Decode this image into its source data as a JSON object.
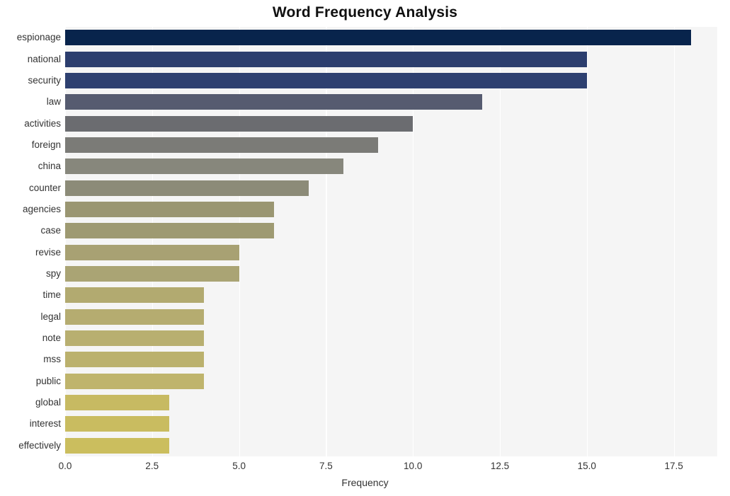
{
  "chart_data": {
    "type": "bar",
    "orientation": "horizontal",
    "title": "Word Frequency Analysis",
    "xlabel": "Frequency",
    "ylabel": "",
    "categories": [
      "espionage",
      "national",
      "security",
      "law",
      "activities",
      "foreign",
      "china",
      "counter",
      "agencies",
      "case",
      "revise",
      "spy",
      "time",
      "legal",
      "note",
      "mss",
      "public",
      "global",
      "interest",
      "effectively"
    ],
    "values": [
      18,
      15,
      15,
      12,
      10,
      9,
      8,
      7,
      6,
      6,
      5,
      5,
      4,
      4,
      4,
      4,
      4,
      3,
      3,
      3
    ],
    "bar_colors": [
      "#08244c",
      "#2c3e6e",
      "#2e4070",
      "#565b70",
      "#6b6c70",
      "#7b7b77",
      "#87877c",
      "#8c8b78",
      "#9a9672",
      "#9e9a72",
      "#a8a173",
      "#aaa474",
      "#b2aa70",
      "#b5ac70",
      "#b8af70",
      "#bbb16d",
      "#bfb46c",
      "#c7ba62",
      "#c9bc60",
      "#cbbe5e"
    ],
    "xticks": [
      "0.0",
      "2.5",
      "5.0",
      "7.5",
      "10.0",
      "12.5",
      "15.0",
      "17.5"
    ],
    "xtick_values": [
      0,
      2.5,
      5,
      7.5,
      10,
      12.5,
      15,
      17.5
    ],
    "xlim": [
      0,
      18.75
    ],
    "grid": true,
    "grid_axis": "x",
    "plot_background": "#f5f5f5",
    "grid_color": "#ffffff",
    "legend": "none",
    "title_color": "#101010",
    "tick_color": "#333333"
  }
}
